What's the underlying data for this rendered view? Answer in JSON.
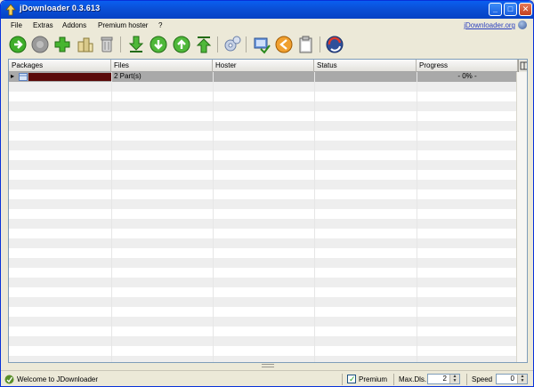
{
  "window": {
    "title": "jDownloader  0.3.613"
  },
  "titlebar_buttons": {
    "minimize": "_",
    "maximize": "□",
    "close": "✕"
  },
  "menu": {
    "items": [
      "File",
      "Extras",
      "Addons",
      "Premium hoster",
      "?"
    ],
    "site_link": "jDownloader.org"
  },
  "toolbar": {
    "tools": [
      "start-icon",
      "stop-icon",
      "add-links-icon",
      "cleanup-icon",
      "remove-icon",
      "move-bottom-icon",
      "move-down-icon",
      "move-up-icon",
      "move-top-icon",
      "settings-icon",
      "reconnect-icon",
      "clipboard-watch-icon",
      "clipboard-icon",
      "update-icon"
    ]
  },
  "table": {
    "columns": [
      "Packages",
      "Files",
      "Hoster",
      "Status",
      "Progress"
    ],
    "rows": [
      {
        "package": "",
        "files": "2 Part(s)",
        "hoster": "",
        "status": "",
        "progress": "- 0% -"
      }
    ]
  },
  "statusbar": {
    "message": "Welcome to JDownloader",
    "premium_label": "Premium",
    "premium_checked": true,
    "max_dls_label": "Max.Dls.",
    "max_dls_value": "2",
    "speed_label": "Speed",
    "speed_value": "0"
  },
  "colors": {
    "titlebar": "#0a4fd6",
    "selected_row": "#a9a9a9",
    "redacted": "#5a0a0a"
  }
}
